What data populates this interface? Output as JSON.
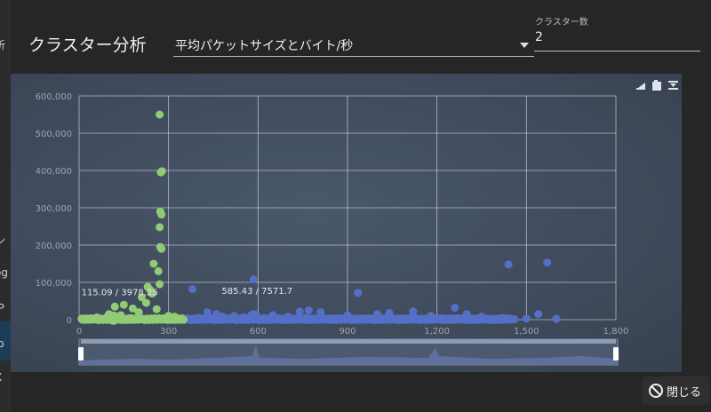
{
  "background_app": {
    "fragments": [
      "析",
      "ン",
      "og",
      "IP",
      "lo",
      "X"
    ]
  },
  "dialog": {
    "title": "クラスター分析",
    "metric_select": {
      "value": "平均パケットサイズとバイト/秒"
    },
    "cluster_count": {
      "label": "クラスター数",
      "value": "2"
    },
    "close_label": "閉じる"
  },
  "toolbox": {
    "icons": [
      "restore-icon",
      "data-view-icon",
      "save-image-icon"
    ]
  },
  "colors": {
    "cluster_0": "#91cc75",
    "cluster_1": "#5470c6",
    "panel": "#3d4859"
  },
  "chart_data": {
    "type": "scatter",
    "xlim": [
      0,
      1800
    ],
    "ylim": [
      0,
      600000
    ],
    "x_ticks": [
      0,
      300,
      600,
      900,
      1200,
      1500,
      1800
    ],
    "y_ticks": [
      0,
      100000,
      200000,
      300000,
      400000,
      500000,
      600000
    ],
    "x_tick_labels": [
      "0",
      "300",
      "600",
      "900",
      "1,200",
      "1,500",
      "1,800"
    ],
    "y_tick_labels": [
      "0",
      "100,000",
      "200,000",
      "300,000",
      "400,000",
      "500,000",
      "600,000"
    ],
    "grid": true,
    "data_zoom": {
      "range": [
        0,
        100
      ]
    },
    "series": [
      {
        "color": "#91cc75",
        "centroid": [
          115.09,
          3978.25
        ],
        "centroid_label": "115.09 / 3978.25",
        "points": [
          [
            270,
            550000
          ],
          [
            278,
            398000
          ],
          [
            274,
            395000
          ],
          [
            272,
            290000
          ],
          [
            276,
            282000
          ],
          [
            270,
            248000
          ],
          [
            272,
            195000
          ],
          [
            276,
            190000
          ],
          [
            250,
            150000
          ],
          [
            266,
            130000
          ],
          [
            270,
            95000
          ],
          [
            230,
            88000
          ],
          [
            238,
            80000
          ],
          [
            245,
            70000
          ],
          [
            210,
            60000
          ],
          [
            225,
            45000
          ],
          [
            150,
            40000
          ],
          [
            120,
            35000
          ],
          [
            180,
            30000
          ],
          [
            260,
            28000
          ],
          [
            200,
            20000
          ],
          [
            100,
            15000
          ],
          [
            140,
            12000
          ],
          [
            300,
            10000
          ],
          [
            320,
            8000
          ],
          [
            60,
            6000
          ],
          [
            90,
            5000
          ],
          [
            170,
            4000
          ],
          [
            250,
            3000
          ],
          [
            40,
            2000
          ],
          [
            20,
            1500
          ],
          [
            80,
            1000
          ],
          [
            110,
            800
          ],
          [
            130,
            600
          ],
          [
            160,
            500
          ],
          [
            190,
            400
          ],
          [
            220,
            300
          ],
          [
            280,
            200
          ],
          [
            310,
            100
          ],
          [
            340,
            50
          ],
          [
            350,
            100
          ]
        ]
      },
      {
        "color": "#5470c6",
        "centroid": [
          585.43,
          7571.7
        ],
        "centroid_label": "585.43 / 7571.7",
        "points": [
          [
            585,
            108000
          ],
          [
            935,
            72000
          ],
          [
            380,
            82000
          ],
          [
            1440,
            148000
          ],
          [
            1570,
            153000
          ],
          [
            770,
            25000
          ],
          [
            740,
            22000
          ],
          [
            810,
            20000
          ],
          [
            1260,
            32000
          ],
          [
            1040,
            18000
          ],
          [
            1120,
            22000
          ],
          [
            1000,
            15000
          ],
          [
            1300,
            15000
          ],
          [
            1540,
            15000
          ],
          [
            900,
            12000
          ],
          [
            650,
            12000
          ],
          [
            460,
            15000
          ],
          [
            520,
            10000
          ],
          [
            430,
            20000
          ],
          [
            700,
            8000
          ],
          [
            1180,
            10000
          ],
          [
            1350,
            8000
          ],
          [
            1420,
            5000
          ],
          [
            1500,
            3000
          ],
          [
            1600,
            2000
          ],
          [
            400,
            5000
          ],
          [
            480,
            8000
          ],
          [
            550,
            6000
          ],
          [
            620,
            4000
          ],
          [
            680,
            3000
          ],
          [
            720,
            2000
          ],
          [
            760,
            5000
          ],
          [
            840,
            4000
          ],
          [
            880,
            3000
          ],
          [
            960,
            2000
          ],
          [
            1080,
            3000
          ],
          [
            1150,
            2000
          ],
          [
            1220,
            4000
          ],
          [
            1380,
            2000
          ],
          [
            1460,
            1000
          ],
          [
            1000,
            500
          ],
          [
            800,
            500
          ],
          [
            600,
            1000
          ],
          [
            1200,
            500
          ],
          [
            1400,
            500
          ]
        ]
      }
    ],
    "dense_bands": [
      {
        "series": 0,
        "x_from": 10,
        "x_to": 360
      },
      {
        "series": 1,
        "x_from": 360,
        "x_to": 1450
      }
    ]
  }
}
